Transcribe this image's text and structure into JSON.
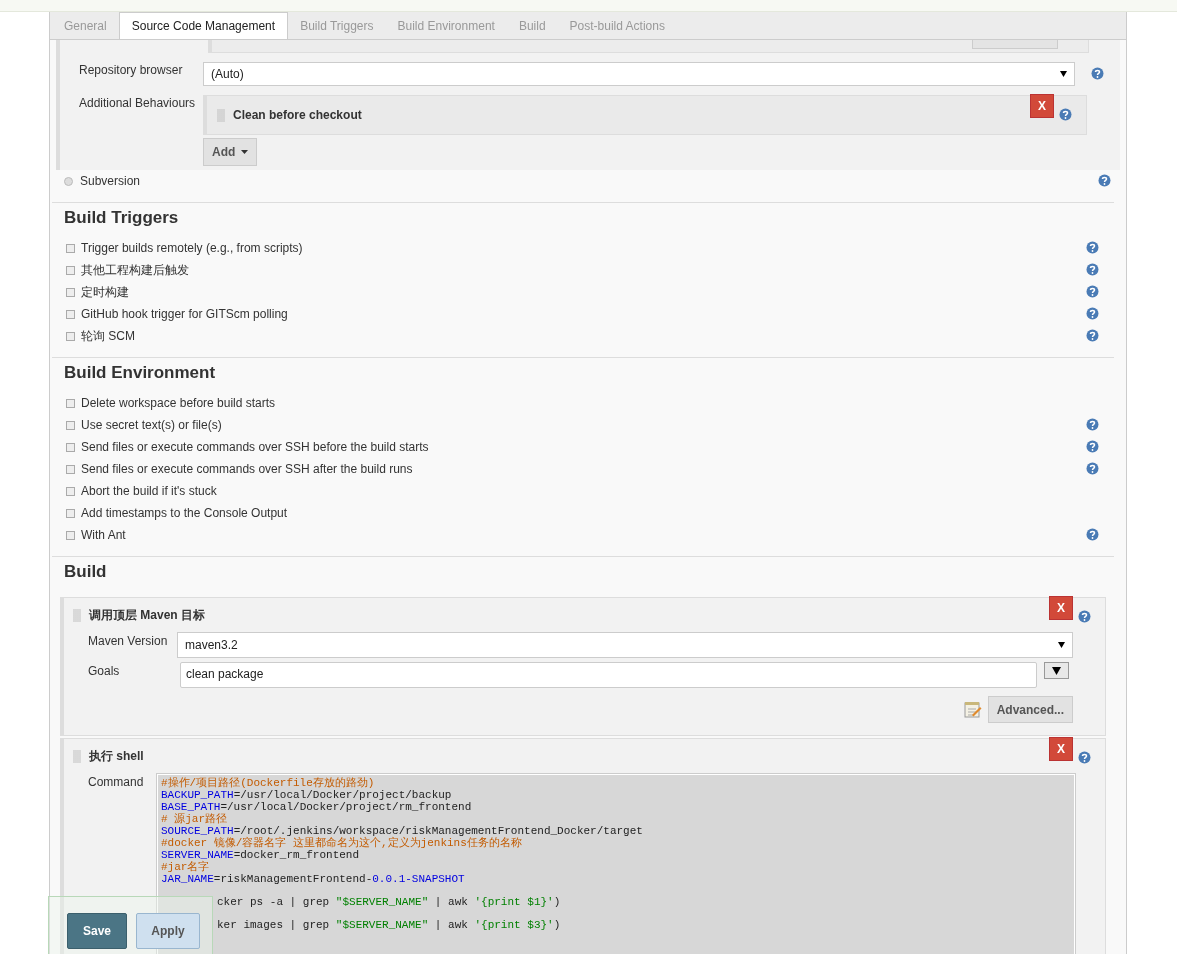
{
  "tabs": [
    {
      "label": "General",
      "selected": false
    },
    {
      "label": "Source Code Management",
      "selected": true
    },
    {
      "label": "Build Triggers",
      "selected": false
    },
    {
      "label": "Build Environment",
      "selected": false
    },
    {
      "label": "Build",
      "selected": false
    },
    {
      "label": "Post-build Actions",
      "selected": false
    }
  ],
  "scm": {
    "repository_browser": {
      "label": "Repository browser",
      "value": "(Auto)"
    },
    "additional_behaviours": {
      "label": "Additional Behaviours",
      "items": [
        {
          "title": "Clean before checkout",
          "delete": "X"
        }
      ],
      "add_button": "Add"
    },
    "options": [
      {
        "label": "Subversion",
        "selected": false
      }
    ]
  },
  "sections": [
    {
      "title": "Build Triggers",
      "options": [
        {
          "label": "Trigger builds remotely (e.g., from scripts)",
          "checked": false,
          "help": true
        },
        {
          "label": "其他工程构建后触发",
          "checked": false,
          "help": true
        },
        {
          "label": "定时构建",
          "checked": false,
          "help": true
        },
        {
          "label": "GitHub hook trigger for GITScm polling",
          "checked": false,
          "help": true
        },
        {
          "label": "轮询 SCM",
          "checked": false,
          "help": true
        }
      ]
    },
    {
      "title": "Build Environment",
      "options": [
        {
          "label": "Delete workspace before build starts",
          "checked": false,
          "help": false
        },
        {
          "label": "Use secret text(s) or file(s)",
          "checked": false,
          "help": true
        },
        {
          "label": "Send files or execute commands over SSH before the build starts",
          "checked": false,
          "help": true
        },
        {
          "label": "Send files or execute commands over SSH after the build runs",
          "checked": false,
          "help": true
        },
        {
          "label": "Abort the build if it's stuck",
          "checked": false,
          "help": false
        },
        {
          "label": "Add timestamps to the Console Output",
          "checked": false,
          "help": false
        },
        {
          "label": "With Ant",
          "checked": false,
          "help": true
        }
      ]
    }
  ],
  "build": {
    "title": "Build",
    "steps": [
      {
        "kind": "maven",
        "title": "调用顶层 Maven 目标",
        "delete": "X",
        "version_label": "Maven Version",
        "version": "maven3.2",
        "goals_label": "Goals",
        "goals": "clean package",
        "advanced": "Advanced..."
      },
      {
        "kind": "shell",
        "title": "执行 shell",
        "delete": "X",
        "command_label": "Command",
        "lines": [
          [
            {
              "kind": "comment",
              "text": "#操作/项目路径(Dockerfile存放的路劲)"
            }
          ],
          [
            {
              "kind": "var",
              "text": "BACKUP_PATH"
            },
            {
              "kind": "plain",
              "text": "=/usr/local/Docker/project/backup"
            }
          ],
          [
            {
              "kind": "var",
              "text": "BASE_PATH"
            },
            {
              "kind": "plain",
              "text": "=/usr/local/Docker/project/rm_frontend"
            }
          ],
          [
            {
              "kind": "comment",
              "text": "# 源jar路径"
            }
          ],
          [
            {
              "kind": "var",
              "text": "SOURCE_PATH"
            },
            {
              "kind": "plain",
              "text": "=/root/.jenkins/workspace/riskManagementFrontend_Docker/target"
            }
          ],
          [
            {
              "kind": "comment",
              "text": "#docker 镜像/容器名字 这里都命名为这个,定义为jenkins任务的名称"
            }
          ],
          [
            {
              "kind": "var",
              "text": "SERVER_NAME"
            },
            {
              "kind": "plain",
              "text": "=docker_rm_frontend"
            }
          ],
          [
            {
              "kind": "comment",
              "text": "#jar名字"
            }
          ],
          [
            {
              "kind": "var",
              "text": "JAR_NAME"
            },
            {
              "kind": "plain",
              "text": "=riskManagementFrontend-"
            },
            {
              "kind": "var",
              "text": "0.0.1-SNAPSHOT"
            }
          ],
          [
            {
              "kind": "plain",
              "text": "cker ps -a | grep ",
              "covered": true
            },
            {
              "kind": "string",
              "text": "\"$SERVER_NAME\""
            },
            {
              "kind": "plain",
              "text": " | awk "
            },
            {
              "kind": "string",
              "text": "'{print $1}'"
            },
            {
              "kind": "plain",
              "text": ")"
            }
          ],
          [
            {
              "kind": "plain",
              "text": "ker images | grep ",
              "covered": true
            },
            {
              "kind": "string",
              "text": "\"$SERVER_NAME\""
            },
            {
              "kind": "plain",
              "text": " | awk "
            },
            {
              "kind": "string",
              "text": "'{print $3}'"
            },
            {
              "kind": "plain",
              "text": ")"
            }
          ]
        ]
      }
    ]
  },
  "actions": [
    {
      "label": "Save",
      "kind": "primary"
    },
    {
      "label": "Apply",
      "kind": "secondary"
    }
  ]
}
